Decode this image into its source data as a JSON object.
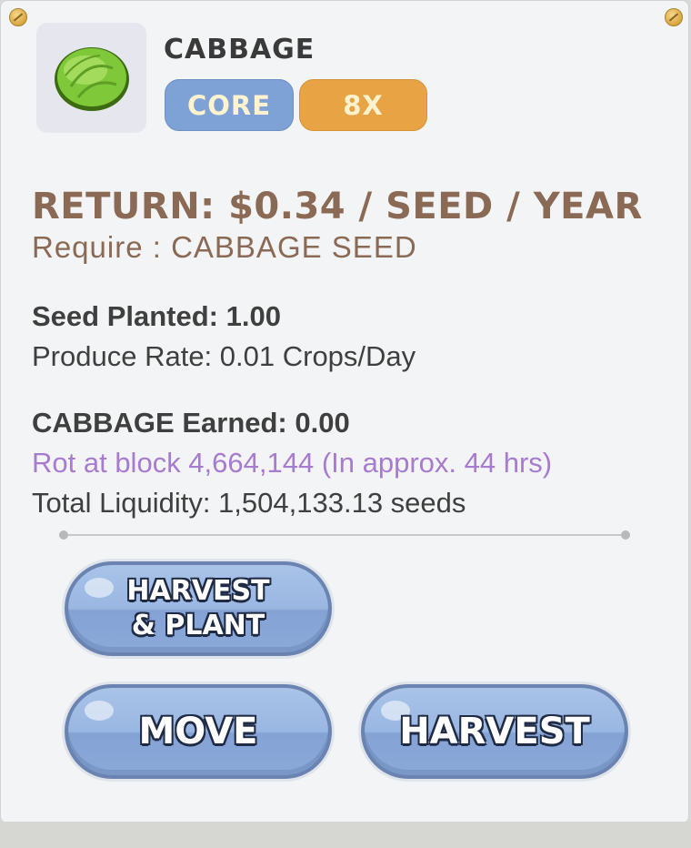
{
  "crop": {
    "name": "CABBAGE",
    "icon": "cabbage-icon",
    "tags": [
      "CORE",
      "8X"
    ]
  },
  "stats": {
    "return": "RETURN: $0.34 / SEED / YEAR",
    "require": "Require : CABBAGE SEED",
    "seed_planted": "Seed Planted: 1.00",
    "produce_rate": "Produce Rate: 0.01 Crops/Day",
    "earned": "CABBAGE Earned: 0.00",
    "rot": "Rot at block 4,664,144 (In approx. 44 hrs)",
    "liquidity": "Total Liquidity: 1,504,133.13 seeds"
  },
  "actions": {
    "harvest_plant_line1": "HARVEST",
    "harvest_plant_line2": "& PLANT",
    "move": "MOVE",
    "harvest": "HARVEST"
  },
  "colors": {
    "core_pill": "#7fa2d6",
    "mult_pill": "#e8a444",
    "return_text": "#8b6a55",
    "rot_text": "#a77bcf",
    "button": "#9ab7e2"
  }
}
